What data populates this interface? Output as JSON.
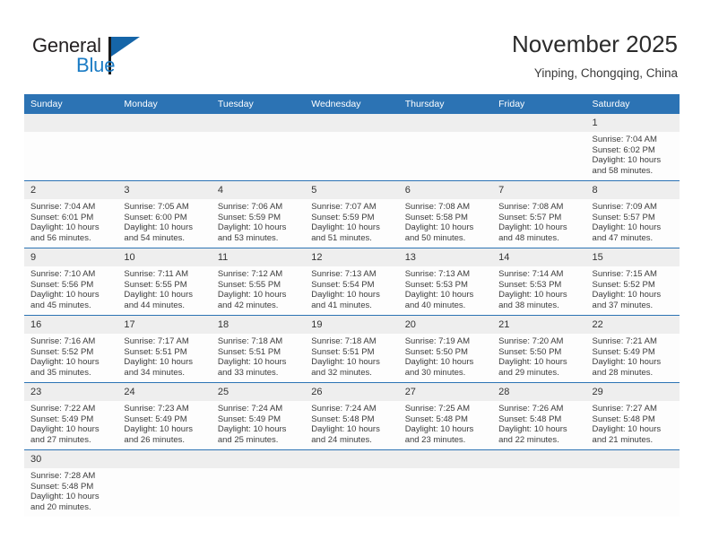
{
  "brand": {
    "name_top": "General",
    "name_bottom": "Blue",
    "accent_color": "#1a7bc4",
    "flag_color": "#1565a8"
  },
  "header": {
    "title": "November 2025",
    "subtitle": "Yinping, Chongqing, China"
  },
  "theme": {
    "header_bg": "#2c73b4",
    "daynum_bg": "#eeeeee",
    "row_border": "#2c73b4",
    "text": "#3c3c3c"
  },
  "weekdays": [
    "Sunday",
    "Monday",
    "Tuesday",
    "Wednesday",
    "Thursday",
    "Friday",
    "Saturday"
  ],
  "weeks": [
    [
      {
        "day": "",
        "sunrise": "",
        "sunset": "",
        "daylight_line1": "",
        "daylight_line2": ""
      },
      {
        "day": "",
        "sunrise": "",
        "sunset": "",
        "daylight_line1": "",
        "daylight_line2": ""
      },
      {
        "day": "",
        "sunrise": "",
        "sunset": "",
        "daylight_line1": "",
        "daylight_line2": ""
      },
      {
        "day": "",
        "sunrise": "",
        "sunset": "",
        "daylight_line1": "",
        "daylight_line2": ""
      },
      {
        "day": "",
        "sunrise": "",
        "sunset": "",
        "daylight_line1": "",
        "daylight_line2": ""
      },
      {
        "day": "",
        "sunrise": "",
        "sunset": "",
        "daylight_line1": "",
        "daylight_line2": ""
      },
      {
        "day": "1",
        "sunrise": "Sunrise: 7:04 AM",
        "sunset": "Sunset: 6:02 PM",
        "daylight_line1": "Daylight: 10 hours",
        "daylight_line2": "and 58 minutes."
      }
    ],
    [
      {
        "day": "2",
        "sunrise": "Sunrise: 7:04 AM",
        "sunset": "Sunset: 6:01 PM",
        "daylight_line1": "Daylight: 10 hours",
        "daylight_line2": "and 56 minutes."
      },
      {
        "day": "3",
        "sunrise": "Sunrise: 7:05 AM",
        "sunset": "Sunset: 6:00 PM",
        "daylight_line1": "Daylight: 10 hours",
        "daylight_line2": "and 54 minutes."
      },
      {
        "day": "4",
        "sunrise": "Sunrise: 7:06 AM",
        "sunset": "Sunset: 5:59 PM",
        "daylight_line1": "Daylight: 10 hours",
        "daylight_line2": "and 53 minutes."
      },
      {
        "day": "5",
        "sunrise": "Sunrise: 7:07 AM",
        "sunset": "Sunset: 5:59 PM",
        "daylight_line1": "Daylight: 10 hours",
        "daylight_line2": "and 51 minutes."
      },
      {
        "day": "6",
        "sunrise": "Sunrise: 7:08 AM",
        "sunset": "Sunset: 5:58 PM",
        "daylight_line1": "Daylight: 10 hours",
        "daylight_line2": "and 50 minutes."
      },
      {
        "day": "7",
        "sunrise": "Sunrise: 7:08 AM",
        "sunset": "Sunset: 5:57 PM",
        "daylight_line1": "Daylight: 10 hours",
        "daylight_line2": "and 48 minutes."
      },
      {
        "day": "8",
        "sunrise": "Sunrise: 7:09 AM",
        "sunset": "Sunset: 5:57 PM",
        "daylight_line1": "Daylight: 10 hours",
        "daylight_line2": "and 47 minutes."
      }
    ],
    [
      {
        "day": "9",
        "sunrise": "Sunrise: 7:10 AM",
        "sunset": "Sunset: 5:56 PM",
        "daylight_line1": "Daylight: 10 hours",
        "daylight_line2": "and 45 minutes."
      },
      {
        "day": "10",
        "sunrise": "Sunrise: 7:11 AM",
        "sunset": "Sunset: 5:55 PM",
        "daylight_line1": "Daylight: 10 hours",
        "daylight_line2": "and 44 minutes."
      },
      {
        "day": "11",
        "sunrise": "Sunrise: 7:12 AM",
        "sunset": "Sunset: 5:55 PM",
        "daylight_line1": "Daylight: 10 hours",
        "daylight_line2": "and 42 minutes."
      },
      {
        "day": "12",
        "sunrise": "Sunrise: 7:13 AM",
        "sunset": "Sunset: 5:54 PM",
        "daylight_line1": "Daylight: 10 hours",
        "daylight_line2": "and 41 minutes."
      },
      {
        "day": "13",
        "sunrise": "Sunrise: 7:13 AM",
        "sunset": "Sunset: 5:53 PM",
        "daylight_line1": "Daylight: 10 hours",
        "daylight_line2": "and 40 minutes."
      },
      {
        "day": "14",
        "sunrise": "Sunrise: 7:14 AM",
        "sunset": "Sunset: 5:53 PM",
        "daylight_line1": "Daylight: 10 hours",
        "daylight_line2": "and 38 minutes."
      },
      {
        "day": "15",
        "sunrise": "Sunrise: 7:15 AM",
        "sunset": "Sunset: 5:52 PM",
        "daylight_line1": "Daylight: 10 hours",
        "daylight_line2": "and 37 minutes."
      }
    ],
    [
      {
        "day": "16",
        "sunrise": "Sunrise: 7:16 AM",
        "sunset": "Sunset: 5:52 PM",
        "daylight_line1": "Daylight: 10 hours",
        "daylight_line2": "and 35 minutes."
      },
      {
        "day": "17",
        "sunrise": "Sunrise: 7:17 AM",
        "sunset": "Sunset: 5:51 PM",
        "daylight_line1": "Daylight: 10 hours",
        "daylight_line2": "and 34 minutes."
      },
      {
        "day": "18",
        "sunrise": "Sunrise: 7:18 AM",
        "sunset": "Sunset: 5:51 PM",
        "daylight_line1": "Daylight: 10 hours",
        "daylight_line2": "and 33 minutes."
      },
      {
        "day": "19",
        "sunrise": "Sunrise: 7:18 AM",
        "sunset": "Sunset: 5:51 PM",
        "daylight_line1": "Daylight: 10 hours",
        "daylight_line2": "and 32 minutes."
      },
      {
        "day": "20",
        "sunrise": "Sunrise: 7:19 AM",
        "sunset": "Sunset: 5:50 PM",
        "daylight_line1": "Daylight: 10 hours",
        "daylight_line2": "and 30 minutes."
      },
      {
        "day": "21",
        "sunrise": "Sunrise: 7:20 AM",
        "sunset": "Sunset: 5:50 PM",
        "daylight_line1": "Daylight: 10 hours",
        "daylight_line2": "and 29 minutes."
      },
      {
        "day": "22",
        "sunrise": "Sunrise: 7:21 AM",
        "sunset": "Sunset: 5:49 PM",
        "daylight_line1": "Daylight: 10 hours",
        "daylight_line2": "and 28 minutes."
      }
    ],
    [
      {
        "day": "23",
        "sunrise": "Sunrise: 7:22 AM",
        "sunset": "Sunset: 5:49 PM",
        "daylight_line1": "Daylight: 10 hours",
        "daylight_line2": "and 27 minutes."
      },
      {
        "day": "24",
        "sunrise": "Sunrise: 7:23 AM",
        "sunset": "Sunset: 5:49 PM",
        "daylight_line1": "Daylight: 10 hours",
        "daylight_line2": "and 26 minutes."
      },
      {
        "day": "25",
        "sunrise": "Sunrise: 7:24 AM",
        "sunset": "Sunset: 5:49 PM",
        "daylight_line1": "Daylight: 10 hours",
        "daylight_line2": "and 25 minutes."
      },
      {
        "day": "26",
        "sunrise": "Sunrise: 7:24 AM",
        "sunset": "Sunset: 5:48 PM",
        "daylight_line1": "Daylight: 10 hours",
        "daylight_line2": "and 24 minutes."
      },
      {
        "day": "27",
        "sunrise": "Sunrise: 7:25 AM",
        "sunset": "Sunset: 5:48 PM",
        "daylight_line1": "Daylight: 10 hours",
        "daylight_line2": "and 23 minutes."
      },
      {
        "day": "28",
        "sunrise": "Sunrise: 7:26 AM",
        "sunset": "Sunset: 5:48 PM",
        "daylight_line1": "Daylight: 10 hours",
        "daylight_line2": "and 22 minutes."
      },
      {
        "day": "29",
        "sunrise": "Sunrise: 7:27 AM",
        "sunset": "Sunset: 5:48 PM",
        "daylight_line1": "Daylight: 10 hours",
        "daylight_line2": "and 21 minutes."
      }
    ],
    [
      {
        "day": "30",
        "sunrise": "Sunrise: 7:28 AM",
        "sunset": "Sunset: 5:48 PM",
        "daylight_line1": "Daylight: 10 hours",
        "daylight_line2": "and 20 minutes."
      },
      {
        "day": "",
        "sunrise": "",
        "sunset": "",
        "daylight_line1": "",
        "daylight_line2": ""
      },
      {
        "day": "",
        "sunrise": "",
        "sunset": "",
        "daylight_line1": "",
        "daylight_line2": ""
      },
      {
        "day": "",
        "sunrise": "",
        "sunset": "",
        "daylight_line1": "",
        "daylight_line2": ""
      },
      {
        "day": "",
        "sunrise": "",
        "sunset": "",
        "daylight_line1": "",
        "daylight_line2": ""
      },
      {
        "day": "",
        "sunrise": "",
        "sunset": "",
        "daylight_line1": "",
        "daylight_line2": ""
      },
      {
        "day": "",
        "sunrise": "",
        "sunset": "",
        "daylight_line1": "",
        "daylight_line2": ""
      }
    ]
  ]
}
